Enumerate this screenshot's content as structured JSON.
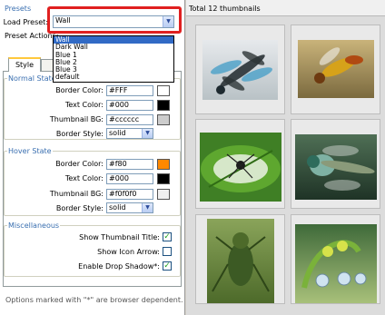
{
  "presets": {
    "section_title": "Presets",
    "load_label": "Load Preset:",
    "current": "Wall",
    "actions_label": "Preset Actions:",
    "options": [
      "Wall",
      "Dark Wall",
      "Blue 1",
      "Blue 2",
      "Blue 3",
      "default"
    ]
  },
  "tabs": [
    "Style",
    ""
  ],
  "normal_state": {
    "title": "Normal State",
    "border_color_label": "Border Color:",
    "border_color": "#FFF",
    "text_color_label": "Text Color:",
    "text_color": "#000",
    "thumb_bg_label": "Thumbnail BG:",
    "thumb_bg": "#cccccc",
    "border_style_label": "Border Style:",
    "border_style": "solid",
    "swatches": [
      "#ffffff",
      "#000000",
      "#cccccc"
    ]
  },
  "hover_state": {
    "title": "Hover State",
    "border_color_label": "Border Color:",
    "border_color": "#f80",
    "text_color_label": "Text Color:",
    "text_color": "#000",
    "thumb_bg_label": "Thumbnail BG:",
    "thumb_bg": "#f0f0f0",
    "border_style_label": "Border Style:",
    "border_style": "solid",
    "swatches": [
      "#ff8800",
      "#000000",
      "#f0f0f0"
    ]
  },
  "misc": {
    "title": "Miscellaneous",
    "show_title_label": "Show Thumbnail Title:",
    "show_title": true,
    "show_icon_label": "Show Icon Arrow:",
    "show_icon": false,
    "drop_shadow_label": "Enable Drop Shadow*:",
    "drop_shadow": true
  },
  "footnote": "Options marked with \"*\" are browser dependent.",
  "gallery": {
    "header": "Total 12 thumbnails",
    "thumbnails": [
      "dragonfly-blue",
      "wasp",
      "leaf-insect",
      "dragonfly-green",
      "grasshopper",
      "plant-droplets"
    ]
  },
  "colors": {
    "accent": "#3a6fb0",
    "highlight": "#316ac5",
    "callout": "#e02020"
  }
}
